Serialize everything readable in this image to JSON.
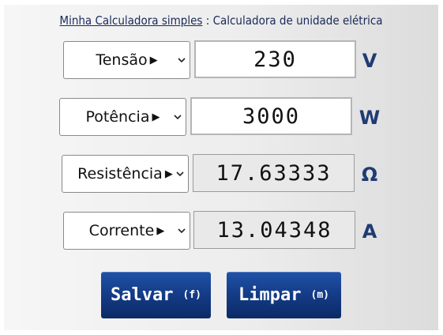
{
  "header": {
    "link_text": "Minha Calculadora simples",
    "separator": " : ",
    "subtitle": "Calculadora de unidade elétrica"
  },
  "rows": [
    {
      "select_label": "Tensão",
      "value": "230",
      "unit": "V",
      "editable": true
    },
    {
      "select_label": "Potência",
      "value": "3000",
      "unit": "W",
      "editable": true
    },
    {
      "select_label": "Resistência",
      "value": "17.63333",
      "unit": "Ω",
      "editable": false
    },
    {
      "select_label": "Corrente",
      "value": "13.04348",
      "unit": "A",
      "editable": false
    }
  ],
  "buttons": {
    "save_label": "Salvar",
    "save_key": "(f)",
    "clear_label": "Limpar",
    "clear_key": "(m)"
  },
  "colors": {
    "accent": "#143b86",
    "unit": "#1f3b74",
    "header": "#1a2a5a"
  },
  "icons": {
    "select_arrow": "play-arrow-icon",
    "dropdown": "chevron-down-icon"
  }
}
